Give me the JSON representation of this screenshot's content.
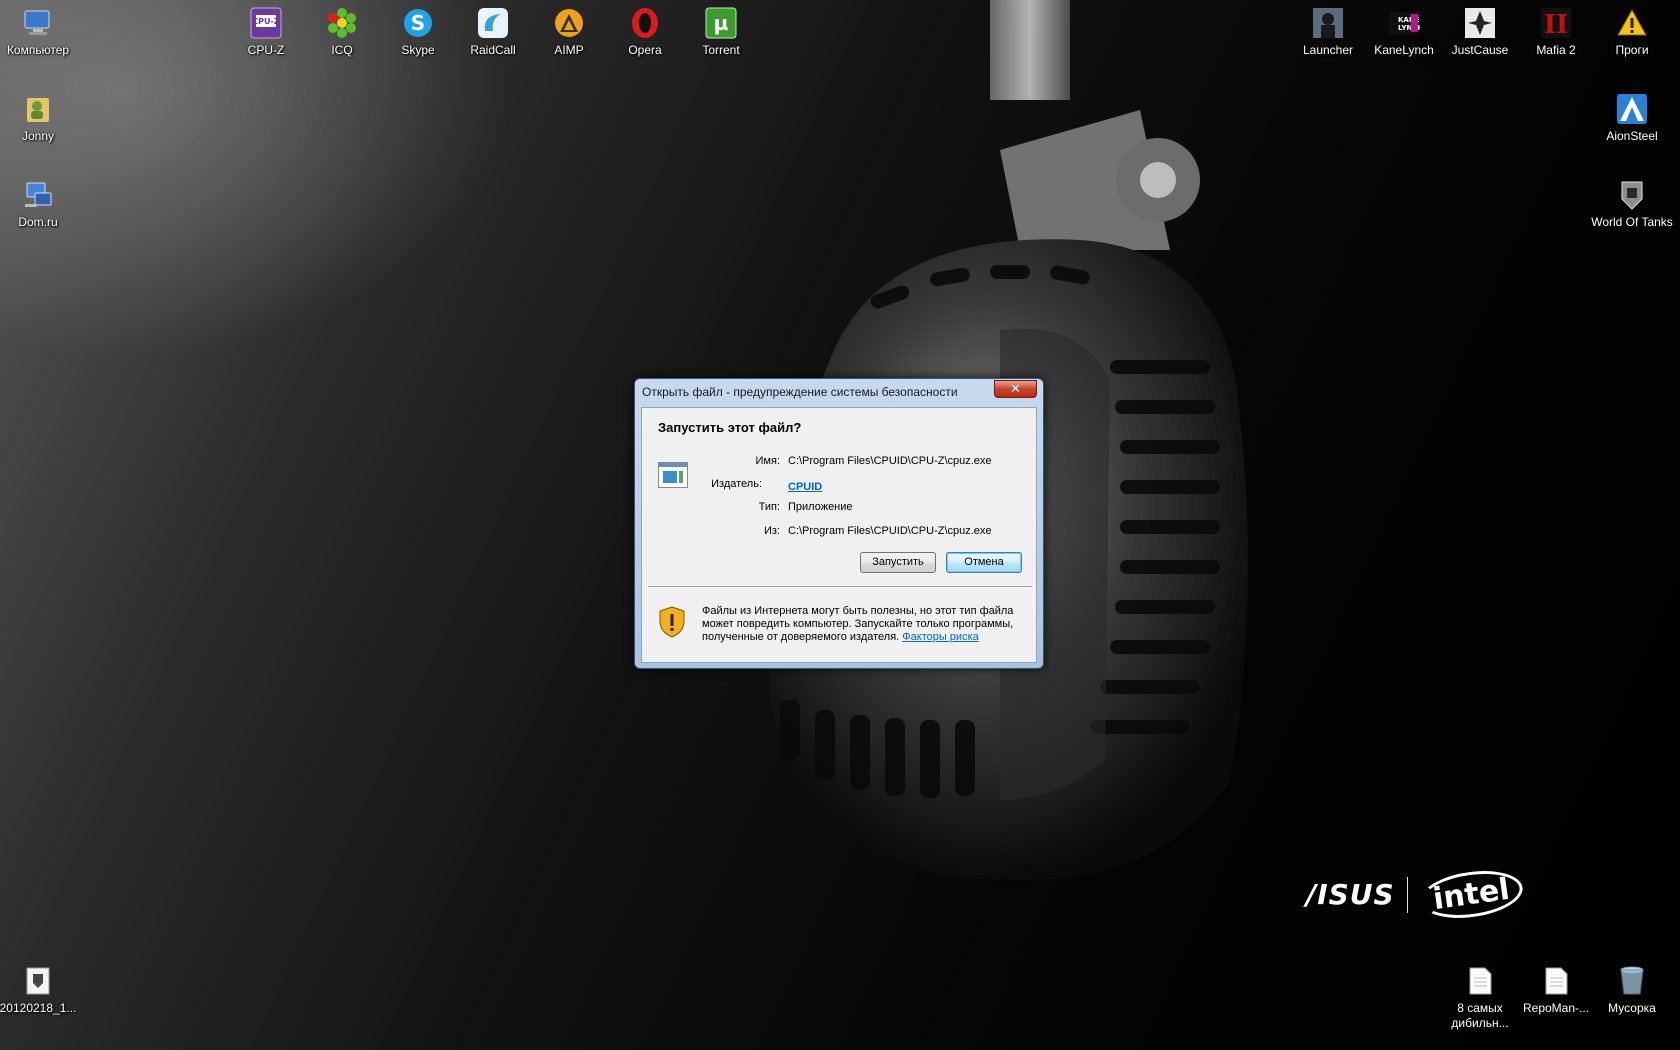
{
  "desktop": {
    "icons_left": [
      {
        "label": "Компьютер",
        "icon": "computer-icon"
      },
      {
        "label": "Jonny",
        "icon": "user-folder-icon"
      },
      {
        "label": "Dom.ru",
        "icon": "network-icon"
      }
    ],
    "icons_top": [
      {
        "label": "CPU-Z",
        "icon": "cpuz-icon",
        "color": "#7b3fa0"
      },
      {
        "label": "ICQ",
        "icon": "icq-flower-icon",
        "color": "#5bbf2c"
      },
      {
        "label": "Skype",
        "icon": "skype-icon",
        "color": "#1fa3e6"
      },
      {
        "label": "RaidCall",
        "icon": "raidcall-icon",
        "color": "#3aa0d8"
      },
      {
        "label": "AIMP",
        "icon": "aimp-icon",
        "color": "#f0a020"
      },
      {
        "label": "Opera",
        "icon": "opera-icon",
        "color": "#d81c1c"
      },
      {
        "label": "Torrent",
        "icon": "utorrent-icon",
        "color": "#3c9b2e"
      }
    ],
    "icons_top_right": [
      {
        "label": "Launcher",
        "icon": "launcher-icon"
      },
      {
        "label": "KaneLynch",
        "icon": "kanelynch-icon"
      },
      {
        "label": "JustCause",
        "icon": "justcause-icon"
      },
      {
        "label": "Mafia 2",
        "icon": "mafia2-icon"
      },
      {
        "label": "Проги",
        "icon": "warning-folder-icon"
      }
    ],
    "icons_right": [
      {
        "label": "AionSteel",
        "icon": "aion-icon"
      },
      {
        "label": "World Of Tanks",
        "icon": "world-of-tanks-icon"
      }
    ],
    "icons_bottom_left": [
      {
        "label": "20120218_1...",
        "icon": "wot-replay-file-icon"
      }
    ],
    "icons_bottom_right": [
      {
        "label": "8 самых дибильн...",
        "icon": "text-file-icon"
      },
      {
        "label": "RepoMan-...",
        "icon": "text-file-icon"
      },
      {
        "label": "Мусорка",
        "icon": "recycle-bin-icon"
      }
    ],
    "brand": {
      "asus": "/ISUS",
      "intel": "intel"
    }
  },
  "dialog": {
    "title": "Открыть файл - предупреждение системы безопасности",
    "close_label": "✕",
    "question": "Запустить этот файл?",
    "fields": {
      "name_label": "Имя:",
      "name_value": "C:\\Program Files\\CPUID\\CPU-Z\\cpuz.exe",
      "publisher_label": "Издатель:",
      "publisher_value": "CPUID",
      "type_label": "Тип:",
      "type_value": "Приложение",
      "from_label": "Из:",
      "from_value": "C:\\Program Files\\CPUID\\CPU-Z\\cpuz.exe"
    },
    "run_button": "Запустить",
    "cancel_button": "Отмена",
    "warning_text": "Файлы из Интернета могут быть полезны, но этот тип файла может повредить компьютер. Запускайте только программы, полученные от доверяемого издателя.",
    "risk_link": "Факторы риска"
  }
}
